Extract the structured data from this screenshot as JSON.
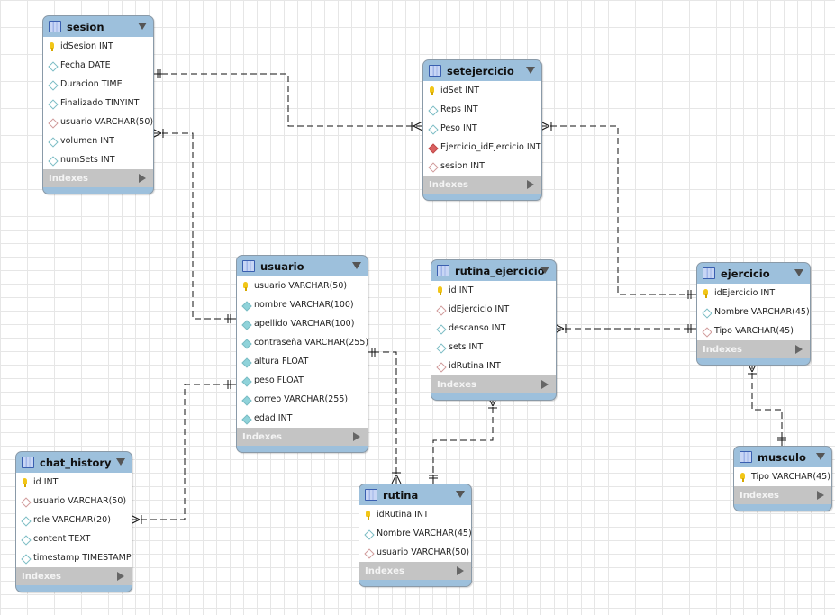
{
  "indexes_label": "Indexes",
  "tables": [
    {
      "id": "sesion",
      "name": "sesion",
      "columns": [
        {
          "text": "idSesion INT",
          "icon": "key"
        },
        {
          "text": "Fecha DATE",
          "icon": "col"
        },
        {
          "text": "Duracion TIME",
          "icon": "col"
        },
        {
          "text": "Finalizado TINYINT",
          "icon": "col"
        },
        {
          "text": "usuario VARCHAR(50)",
          "icon": "fk"
        },
        {
          "text": "volumen INT",
          "icon": "col"
        },
        {
          "text": "numSets INT",
          "icon": "col"
        }
      ]
    },
    {
      "id": "setejercicio",
      "name": "setejercicio",
      "columns": [
        {
          "text": "idSet INT",
          "icon": "key"
        },
        {
          "text": "Reps INT",
          "icon": "col"
        },
        {
          "text": "Peso INT",
          "icon": "col"
        },
        {
          "text": "Ejercicio_idEjercicio INT",
          "icon": "fk-nn"
        },
        {
          "text": "sesion INT",
          "icon": "fk"
        }
      ]
    },
    {
      "id": "usuario",
      "name": "usuario",
      "columns": [
        {
          "text": "usuario VARCHAR(50)",
          "icon": "key"
        },
        {
          "text": "nombre VARCHAR(100)",
          "icon": "col-nn"
        },
        {
          "text": "apellido VARCHAR(100)",
          "icon": "col-nn"
        },
        {
          "text": "contraseña VARCHAR(255)",
          "icon": "col-nn"
        },
        {
          "text": "altura FLOAT",
          "icon": "col-nn"
        },
        {
          "text": "peso FLOAT",
          "icon": "col-nn"
        },
        {
          "text": "correo VARCHAR(255)",
          "icon": "col-nn"
        },
        {
          "text": "edad INT",
          "icon": "col-nn"
        }
      ]
    },
    {
      "id": "rutina_ejercicio",
      "name": "rutina_ejercicio",
      "columns": [
        {
          "text": "id INT",
          "icon": "key"
        },
        {
          "text": "idEjercicio INT",
          "icon": "fk"
        },
        {
          "text": "descanso INT",
          "icon": "col"
        },
        {
          "text": "sets INT",
          "icon": "col"
        },
        {
          "text": "idRutina INT",
          "icon": "fk"
        }
      ]
    },
    {
      "id": "ejercicio",
      "name": "ejercicio",
      "columns": [
        {
          "text": "idEjercicio INT",
          "icon": "key"
        },
        {
          "text": "Nombre VARCHAR(45)",
          "icon": "col"
        },
        {
          "text": "Tipo VARCHAR(45)",
          "icon": "fk"
        }
      ]
    },
    {
      "id": "musculo",
      "name": "musculo",
      "columns": [
        {
          "text": "Tipo VARCHAR(45)",
          "icon": "key"
        }
      ]
    },
    {
      "id": "chat_history",
      "name": "chat_history",
      "columns": [
        {
          "text": "id INT",
          "icon": "key"
        },
        {
          "text": "usuario VARCHAR(50)",
          "icon": "fk"
        },
        {
          "text": "role VARCHAR(20)",
          "icon": "col"
        },
        {
          "text": "content TEXT",
          "icon": "col"
        },
        {
          "text": "timestamp TIMESTAMP",
          "icon": "col"
        }
      ]
    },
    {
      "id": "rutina",
      "name": "rutina",
      "columns": [
        {
          "text": "idRutina INT",
          "icon": "key"
        },
        {
          "text": "Nombre VARCHAR(45)",
          "icon": "col"
        },
        {
          "text": "usuario VARCHAR(50)",
          "icon": "fk"
        }
      ]
    }
  ],
  "relationships": [
    {
      "from": "sesion",
      "to": "setejercicio",
      "from_card": "one",
      "to_card": "many"
    },
    {
      "from": "usuario",
      "to": "sesion",
      "from_card": "one",
      "to_card": "many"
    },
    {
      "from": "ejercicio",
      "to": "setejercicio",
      "from_card": "one",
      "to_card": "many"
    },
    {
      "from": "ejercicio",
      "to": "rutina_ejercicio",
      "from_card": "one",
      "to_card": "many"
    },
    {
      "from": "musculo",
      "to": "ejercicio",
      "from_card": "one",
      "to_card": "many"
    },
    {
      "from": "usuario",
      "to": "rutina",
      "from_card": "one",
      "to_card": "many"
    },
    {
      "from": "rutina",
      "to": "rutina_ejercicio",
      "from_card": "one",
      "to_card": "many"
    },
    {
      "from": "usuario",
      "to": "chat_history",
      "from_card": "one",
      "to_card": "many"
    }
  ]
}
